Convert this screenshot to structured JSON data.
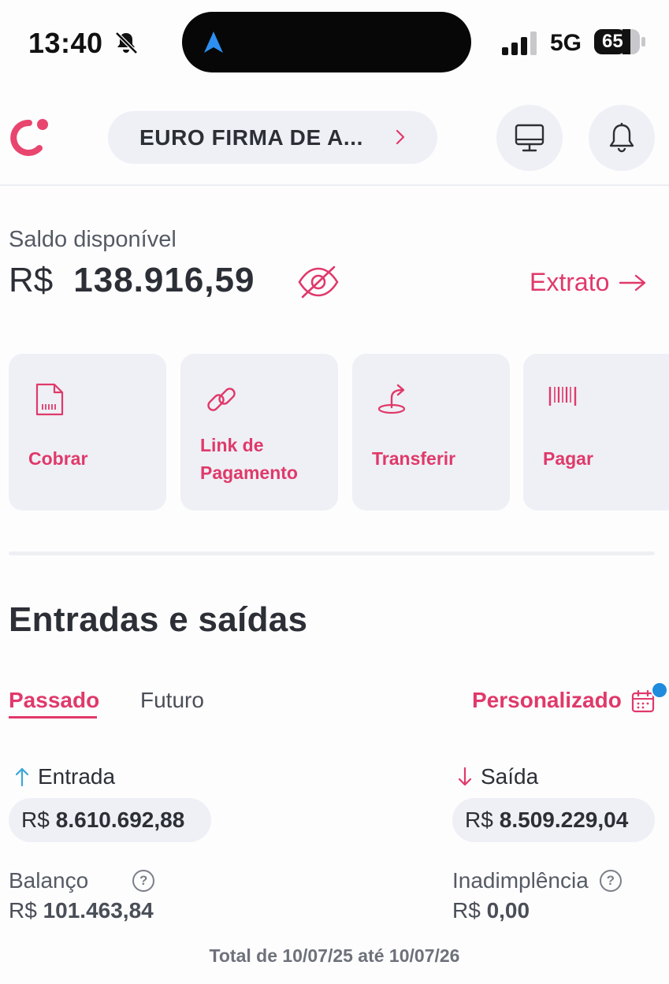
{
  "status_bar": {
    "time": "13:40",
    "network": "5G",
    "battery": "65",
    "icons": [
      "bell-slash-icon",
      "navigation-arrow-icon",
      "signal-icon",
      "battery-icon"
    ]
  },
  "header": {
    "company_name": "EURO FIRMA DE A...",
    "icons": [
      "logo",
      "chevron-right-icon",
      "desktop-icon",
      "bell-icon"
    ]
  },
  "balance": {
    "label": "Saldo disponível",
    "currency": "R$",
    "amount": "138.916,59",
    "statement_link": "Extrato",
    "icons": [
      "eye-slash-icon",
      "arrow-right-icon"
    ]
  },
  "actions": [
    {
      "label_line1": "Cobrar",
      "label_line2": "",
      "icon": "invoice-icon"
    },
    {
      "label_line1": "Link de",
      "label_line2": "Pagamento",
      "icon": "link-icon"
    },
    {
      "label_line1": "Transferir",
      "label_line2": "",
      "icon": "transfer-icon"
    },
    {
      "label_line1": "Pagar",
      "label_line2": "",
      "icon": "barcode-icon"
    }
  ],
  "cashflow": {
    "title": "Entradas e saídas",
    "tabs": [
      "Passado",
      "Futuro"
    ],
    "active_tab": "Passado",
    "filter_label": "Personalizado",
    "income": {
      "label": "Entrada",
      "currency": "R$",
      "amount": "8.610.692,88"
    },
    "expense": {
      "label": "Saída",
      "currency": "R$",
      "amount": "8.509.229,04"
    },
    "balance": {
      "label": "Balanço",
      "currency": "R$",
      "amount": "101.463,84"
    },
    "default": {
      "label": "Inadimplência",
      "currency": "R$",
      "amount": "0,00"
    },
    "help_symbol": "?",
    "range_text": "Total de 10/07/25 até 10/07/26"
  },
  "colors": {
    "accent": "#e0396a",
    "surface": "#eef0f5",
    "income_arrow": "#3aa6d8",
    "expense_arrow": "#e0396a",
    "notification_dot": "#1f8bdc"
  }
}
